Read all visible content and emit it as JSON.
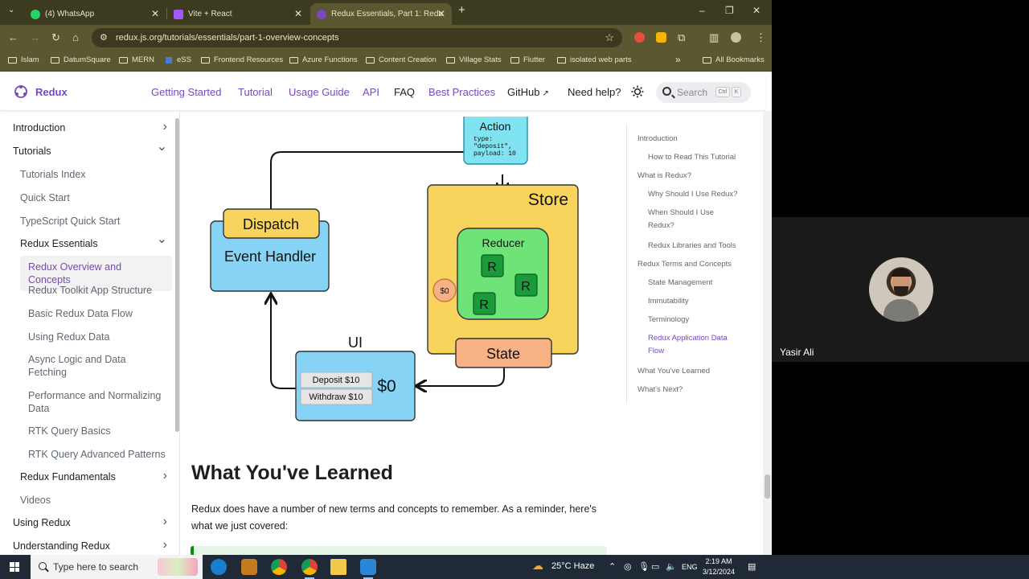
{
  "browser": {
    "tabs": [
      {
        "label": "(4) WhatsApp",
        "favicon_color": "#25d366"
      },
      {
        "label": "Vite + React",
        "favicon_color": "#a259ff"
      },
      {
        "label": "Redux Essentials, Part 1: Redu",
        "favicon_color": "#764abc"
      }
    ],
    "new_tab": "+",
    "window_controls": {
      "minimize": "–",
      "restore": "❐",
      "close": "✕"
    },
    "url": "redux.js.org/tutorials/essentials/part-1-overview-concepts",
    "bookmarks": [
      "Islam",
      "DatumSquare",
      "MERN",
      "eSS",
      "Frontend Resources",
      "Azure Functions",
      "Content Creation",
      "Village Stats",
      "Flutter",
      "isolated web parts",
      "All Bookmarks"
    ],
    "bookmarks_overflow": "»"
  },
  "site": {
    "brand": "Redux",
    "nav": [
      "Getting Started",
      "Tutorial",
      "Usage Guide",
      "API",
      "FAQ",
      "Best Practices",
      "GitHub",
      "Need help?"
    ],
    "search_placeholder": "Search",
    "search_keys": [
      "Ctrl",
      "K"
    ],
    "accent": "#764abc"
  },
  "sidebar": {
    "items": [
      {
        "label": "Introduction",
        "chevron": "›"
      },
      {
        "label": "Tutorials",
        "chevron": "⌄"
      },
      {
        "label": "Tutorials Index"
      },
      {
        "label": "Quick Start"
      },
      {
        "label": "TypeScript Quick Start"
      },
      {
        "label": "Redux Essentials",
        "chevron": "⌄"
      },
      {
        "label": "Redux Overview and Concepts"
      },
      {
        "label": "Redux Toolkit App Structure"
      },
      {
        "label": "Basic Redux Data Flow"
      },
      {
        "label": "Using Redux Data"
      },
      {
        "label": "Async Logic and Data Fetching"
      },
      {
        "label": "Performance and Normalizing Data"
      },
      {
        "label": "RTK Query Basics"
      },
      {
        "label": "RTK Query Advanced Patterns"
      },
      {
        "label": "Redux Fundamentals",
        "chevron": "›"
      },
      {
        "label": "Videos"
      },
      {
        "label": "Using Redux",
        "chevron": "›"
      },
      {
        "label": "Understanding Redux",
        "chevron": "›"
      }
    ]
  },
  "diagram": {
    "action_title": "Action",
    "action_line1": "type:",
    "action_line2": "\"deposit\",",
    "action_line3": "payload: 10",
    "store": "Store",
    "reducer": "Reducer",
    "r": "R",
    "state_value": "$0",
    "state": "State",
    "dispatch": "Dispatch",
    "event_handler": "Event Handler",
    "ui": "UI",
    "deposit_button": "Deposit $10",
    "withdraw_button": "Withdraw $10",
    "ui_value": "$0"
  },
  "content": {
    "heading": "What You've Learned",
    "paragraph": "Redux does have a number of new terms and concepts to remember. As a reminder, here's what we just covered:"
  },
  "toc": [
    {
      "label": "Introduction"
    },
    {
      "label": "How to Read This Tutorial"
    },
    {
      "label": "What is Redux?"
    },
    {
      "label": "Why Should I Use Redux?"
    },
    {
      "label": "When Should I Use Redux?"
    },
    {
      "label": "Redux Libraries and Tools"
    },
    {
      "label": "Redux Terms and Concepts"
    },
    {
      "label": "State Management"
    },
    {
      "label": "Immutability"
    },
    {
      "label": "Terminology"
    },
    {
      "label": "Redux Application Data Flow"
    },
    {
      "label": "What You've Learned"
    },
    {
      "label": "What's Next?"
    }
  ],
  "call": {
    "name": "Yasir Ali"
  },
  "taskbar": {
    "search_placeholder": "Type here to search",
    "weather": "25°C Haze",
    "language": "ENG",
    "time": "2:19 AM",
    "date": "3/12/2024"
  }
}
